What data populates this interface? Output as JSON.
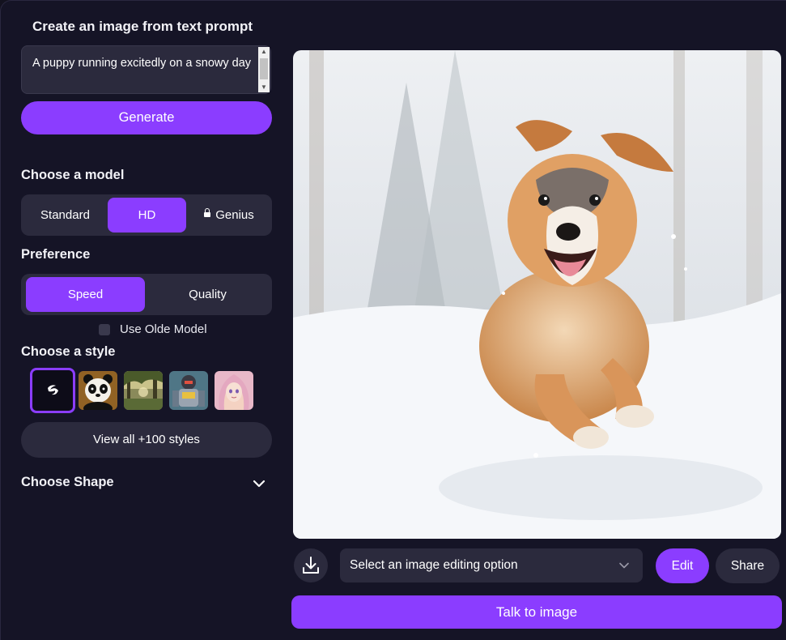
{
  "prompt_panel": {
    "title": "Create an image from text prompt",
    "prompt_value": "A puppy running excitedly on a snowy day",
    "generate_label": "Generate"
  },
  "model": {
    "label": "Choose a model",
    "options": [
      "Standard",
      "HD",
      "Genius"
    ],
    "selected": "HD",
    "locked": [
      "Genius"
    ]
  },
  "preference": {
    "label": "Preference",
    "options": [
      "Speed",
      "Quality"
    ],
    "selected": "Speed"
  },
  "olde_model": {
    "label": "Use Olde Model",
    "checked": false
  },
  "style": {
    "label": "Choose a style",
    "thumbnails": [
      "no-style-icon",
      "panda",
      "forest",
      "robot",
      "anime-girl"
    ],
    "selected": "no-style-icon",
    "view_all_label": "View all +100 styles"
  },
  "shape": {
    "label": "Choose Shape",
    "expanded": false
  },
  "result": {
    "image_subject": "puppy running in snow",
    "edit_select_placeholder": "Select an image editing option",
    "edit_label": "Edit",
    "share_label": "Share",
    "talk_label": "Talk to image"
  },
  "colors": {
    "accent": "#8b3dff",
    "panel": "#2b2a3d",
    "background": "#151426"
  }
}
